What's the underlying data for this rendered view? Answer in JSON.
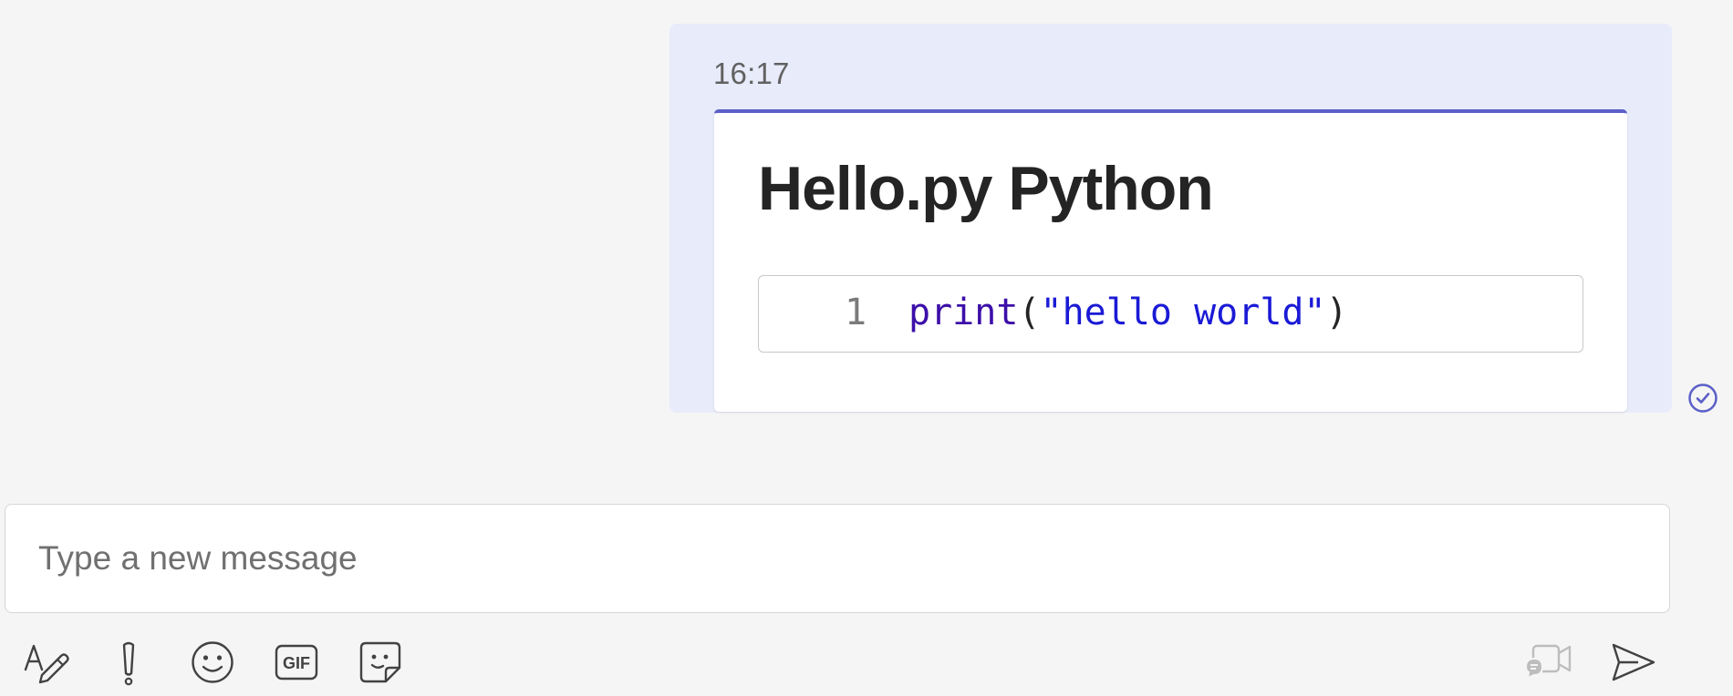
{
  "message": {
    "timestamp": "16:17",
    "card": {
      "title": "Hello.py Python",
      "code": {
        "line_number": "1",
        "tokens": {
          "fn": "print",
          "open": "(",
          "str": "\"hello world\"",
          "close": ")"
        }
      }
    },
    "status_icon": "read-receipt-check-icon"
  },
  "compose": {
    "placeholder": "Type a new message",
    "value": ""
  },
  "toolbar": {
    "icons": [
      "format-icon",
      "important-icon",
      "emoji-icon",
      "gif-icon",
      "sticker-icon",
      "meet-now-icon",
      "send-icon"
    ]
  },
  "colors": {
    "accent": "#5b5fc7",
    "bubble_bg": "#e8ebfa",
    "page_bg": "#f5f5f5"
  }
}
